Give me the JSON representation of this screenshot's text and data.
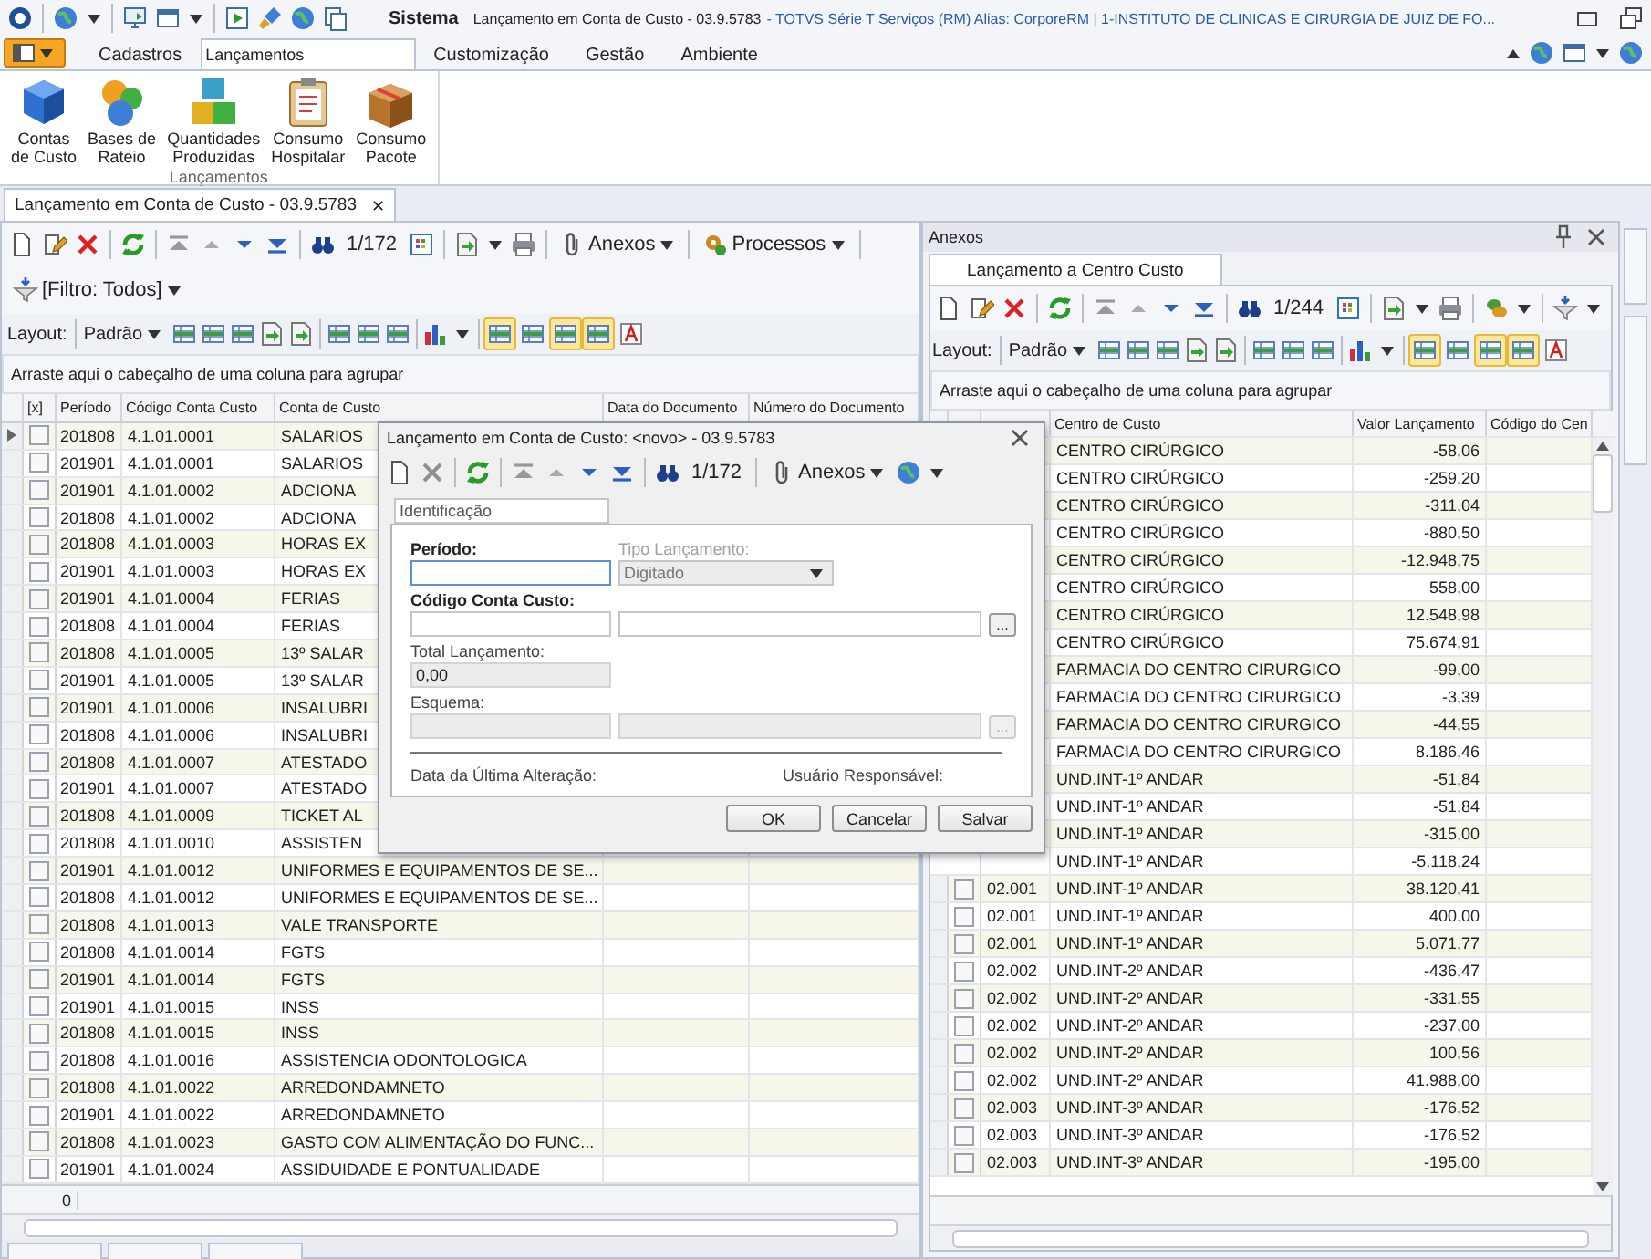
{
  "titlebar": {
    "app": "Sistema",
    "title": "Lançamento em Conta de Custo - 03.9.5783",
    "subtitle": "- TOTVS Série T Serviços (RM) Alias: CorporeRM | 1-INSTITUTO DE CLINICAS E CIRURGIA DE JUIZ DE FO..."
  },
  "ribbon_tabs": [
    {
      "label": "Cadastros",
      "selected": false
    },
    {
      "label": "Lançamentos",
      "selected": true
    },
    {
      "label": "Customização",
      "selected": false
    },
    {
      "label": "Gestão",
      "selected": false
    },
    {
      "label": "Ambiente",
      "selected": false
    }
  ],
  "ribbon_buttons": [
    {
      "lines": [
        "Contas",
        "de Custo"
      ]
    },
    {
      "lines": [
        "Bases de",
        "Rateio"
      ]
    },
    {
      "lines": [
        "Quantidades",
        "Produzidas"
      ]
    },
    {
      "lines": [
        "Consumo",
        "Hospitalar"
      ]
    },
    {
      "lines": [
        "Consumo",
        "Pacote"
      ]
    }
  ],
  "ribbon_group": "Lançamentos",
  "document_tab": {
    "label": "Lançamento em Conta de Custo - 03.9.5783",
    "close": "✕"
  },
  "left": {
    "counter": "1/172",
    "attachments": "Anexos",
    "processes": "Processos",
    "filter": "[Filtro: Todos]",
    "layout_label": "Layout:",
    "layout_value": "Padrão",
    "layout_toggles": [
      {
        "on": true
      },
      {
        "on": false
      },
      {
        "on": true
      },
      {
        "on": true
      },
      {
        "on": false
      }
    ],
    "group_hint": "Arraste aqui o cabeçalho de uma coluna para agrupar",
    "columns": [
      "[x]",
      "Período",
      "Código Conta Custo",
      "Conta de Custo",
      "Data do Documento",
      "Número do Documento"
    ],
    "rows": [
      {
        "period": "201808",
        "code": "4.1.01.0001",
        "account": "SALARIOS",
        "checked": false,
        "selected": true
      },
      {
        "period": "201901",
        "code": "4.1.01.0001",
        "account": "SALARIOS",
        "checked": false,
        "selected": false
      },
      {
        "period": "201901",
        "code": "4.1.01.0002",
        "account": "ADCIONA",
        "checked": false,
        "selected": false
      },
      {
        "period": "201808",
        "code": "4.1.01.0002",
        "account": "ADCIONA",
        "checked": false,
        "selected": false
      },
      {
        "period": "201808",
        "code": "4.1.01.0003",
        "account": "HORAS EX",
        "checked": false,
        "selected": false
      },
      {
        "period": "201901",
        "code": "4.1.01.0003",
        "account": "HORAS EX",
        "checked": false,
        "selected": false
      },
      {
        "period": "201901",
        "code": "4.1.01.0004",
        "account": "FERIAS",
        "checked": false,
        "selected": false
      },
      {
        "period": "201808",
        "code": "4.1.01.0004",
        "account": "FERIAS",
        "checked": false,
        "selected": false
      },
      {
        "period": "201808",
        "code": "4.1.01.0005",
        "account": "13º SALAR",
        "checked": false,
        "selected": false
      },
      {
        "period": "201901",
        "code": "4.1.01.0005",
        "account": "13º SALAR",
        "checked": false,
        "selected": false
      },
      {
        "period": "201901",
        "code": "4.1.01.0006",
        "account": "INSALUBRI",
        "checked": false,
        "selected": false
      },
      {
        "period": "201808",
        "code": "4.1.01.0006",
        "account": "INSALUBRI",
        "checked": false,
        "selected": false
      },
      {
        "period": "201808",
        "code": "4.1.01.0007",
        "account": "ATESTADO",
        "checked": false,
        "selected": false
      },
      {
        "period": "201901",
        "code": "4.1.01.0007",
        "account": "ATESTADO",
        "checked": false,
        "selected": false
      },
      {
        "period": "201808",
        "code": "4.1.01.0009",
        "account": "TICKET AL",
        "checked": false,
        "selected": false
      },
      {
        "period": "201808",
        "code": "4.1.01.0010",
        "account": "ASSISTEN",
        "checked": false,
        "selected": false
      },
      {
        "period": "201901",
        "code": "4.1.01.0012",
        "account": "UNIFORMES E EQUIPAMENTOS DE SE...",
        "checked": false,
        "selected": false
      },
      {
        "period": "201808",
        "code": "4.1.01.0012",
        "account": "UNIFORMES E EQUIPAMENTOS DE SE...",
        "checked": false,
        "selected": false
      },
      {
        "period": "201808",
        "code": "4.1.01.0013",
        "account": "VALE TRANSPORTE",
        "checked": false,
        "selected": false
      },
      {
        "period": "201808",
        "code": "4.1.01.0014",
        "account": "FGTS",
        "checked": false,
        "selected": false
      },
      {
        "period": "201901",
        "code": "4.1.01.0014",
        "account": "FGTS",
        "checked": false,
        "selected": false
      },
      {
        "period": "201901",
        "code": "4.1.01.0015",
        "account": "INSS",
        "checked": false,
        "selected": false
      },
      {
        "period": "201808",
        "code": "4.1.01.0015",
        "account": "INSS",
        "checked": false,
        "selected": false
      },
      {
        "period": "201808",
        "code": "4.1.01.0016",
        "account": "ASSISTENCIA ODONTOLOGICA",
        "checked": false,
        "selected": false
      },
      {
        "period": "201808",
        "code": "4.1.01.0022",
        "account": "ARREDONDAMNETO",
        "checked": false,
        "selected": false
      },
      {
        "period": "201901",
        "code": "4.1.01.0022",
        "account": "ARREDONDAMNETO",
        "checked": false,
        "selected": false
      },
      {
        "period": "201808",
        "code": "4.1.01.0023",
        "account": "GASTO COM ALIMENTAÇÃO DO FUNC...",
        "checked": false,
        "selected": false
      },
      {
        "period": "201901",
        "code": "4.1.01.0024",
        "account": "ASSIDUIDADE E PONTUALIDADE",
        "checked": false,
        "selected": false
      }
    ],
    "footer_count": "0"
  },
  "right": {
    "title": "Anexos",
    "tab": "Lançamento a Centro Custo",
    "counter": "1/244",
    "layout_label": "Layout:",
    "layout_value": "Padrão",
    "layout_toggles": [
      {
        "on": true
      },
      {
        "on": false
      },
      {
        "on": true
      },
      {
        "on": true
      },
      {
        "on": false
      }
    ],
    "group_hint": "Arraste aqui o cabeçalho de uma coluna para agrupar",
    "columns": [
      "Centro de Custo",
      "Valor Lançamento",
      "Código do Cen"
    ],
    "rows": [
      {
        "cost_center": "CENTRO CIRÚRGICO",
        "amount": "-58,06"
      },
      {
        "cost_center": "CENTRO CIRÚRGICO",
        "amount": "-259,20"
      },
      {
        "cost_center": "CENTRO CIRÚRGICO",
        "amount": "-311,04"
      },
      {
        "cost_center": "CENTRO CIRÚRGICO",
        "amount": "-880,50"
      },
      {
        "cost_center": "CENTRO CIRÚRGICO",
        "amount": "-12.948,75"
      },
      {
        "cost_center": "CENTRO CIRÚRGICO",
        "amount": "558,00"
      },
      {
        "cost_center": "CENTRO CIRÚRGICO",
        "amount": "12.548,98"
      },
      {
        "cost_center": "CENTRO CIRÚRGICO",
        "amount": "75.674,91"
      },
      {
        "cost_center": "FARMACIA DO CENTRO CIRURGICO",
        "amount": "-99,00"
      },
      {
        "cost_center": "FARMACIA DO CENTRO CIRURGICO",
        "amount": "-3,39"
      },
      {
        "cost_center": "FARMACIA DO CENTRO CIRURGICO",
        "amount": "-44,55"
      },
      {
        "cost_center": "FARMACIA DO CENTRO CIRURGICO",
        "amount": "8.186,46"
      },
      {
        "cost_center": "UND.INT-1º ANDAR",
        "amount": "-51,84"
      },
      {
        "cost_center": "UND.INT-1º ANDAR",
        "amount": "-51,84"
      },
      {
        "cost_center": "UND.INT-1º ANDAR",
        "amount": "-315,00"
      },
      {
        "cost_center": "UND.INT-1º ANDAR",
        "amount": "-5.118,24"
      },
      {
        "code": "02.001",
        "cost_center": "UND.INT-1º ANDAR",
        "amount": "38.120,41",
        "checked": false
      },
      {
        "code": "02.001",
        "cost_center": "UND.INT-1º ANDAR",
        "amount": "400,00",
        "checked": false
      },
      {
        "code": "02.001",
        "cost_center": "UND.INT-1º ANDAR",
        "amount": "5.071,77",
        "checked": false
      },
      {
        "code": "02.002",
        "cost_center": "UND.INT-2º ANDAR",
        "amount": "-436,47",
        "checked": false
      },
      {
        "code": "02.002",
        "cost_center": "UND.INT-2º ANDAR",
        "amount": "-331,55",
        "checked": false
      },
      {
        "code": "02.002",
        "cost_center": "UND.INT-2º ANDAR",
        "amount": "-237,00",
        "checked": false
      },
      {
        "code": "02.002",
        "cost_center": "UND.INT-2º ANDAR",
        "amount": "100,56",
        "checked": false
      },
      {
        "code": "02.002",
        "cost_center": "UND.INT-2º ANDAR",
        "amount": "41.988,00",
        "checked": false
      },
      {
        "code": "02.003",
        "cost_center": "UND.INT-3º ANDAR",
        "amount": "-176,52",
        "checked": false
      },
      {
        "code": "02.003",
        "cost_center": "UND.INT-3º ANDAR",
        "amount": "-176,52",
        "checked": false
      },
      {
        "code": "02.003",
        "cost_center": "UND.INT-3º ANDAR",
        "amount": "-195,00",
        "checked": false
      }
    ]
  },
  "dialog": {
    "title": "Lançamento em Conta de Custo: <novo> - 03.9.5783",
    "counter": "1/172",
    "attachments": "Anexos",
    "tabs": [
      {
        "label": "Identificação",
        "selected": true
      }
    ],
    "period": {
      "label": "Período:"
    },
    "type": {
      "label": "Tipo Lançamento:",
      "value": "Digitado",
      "disabled": true
    },
    "account": {
      "label": "Código Conta Custo:",
      "browse": "...",
      "disabled": false
    },
    "total": {
      "label": "Total Lançamento:",
      "value": "0,00"
    },
    "scheme": {
      "label": "Esquema:",
      "browse": "...",
      "disabled": true
    },
    "last_change": "Data da Última Alteração:",
    "user": "Usuário Responsável:",
    "buttons": [
      "OK",
      "Cancelar",
      "Salvar"
    ]
  }
}
